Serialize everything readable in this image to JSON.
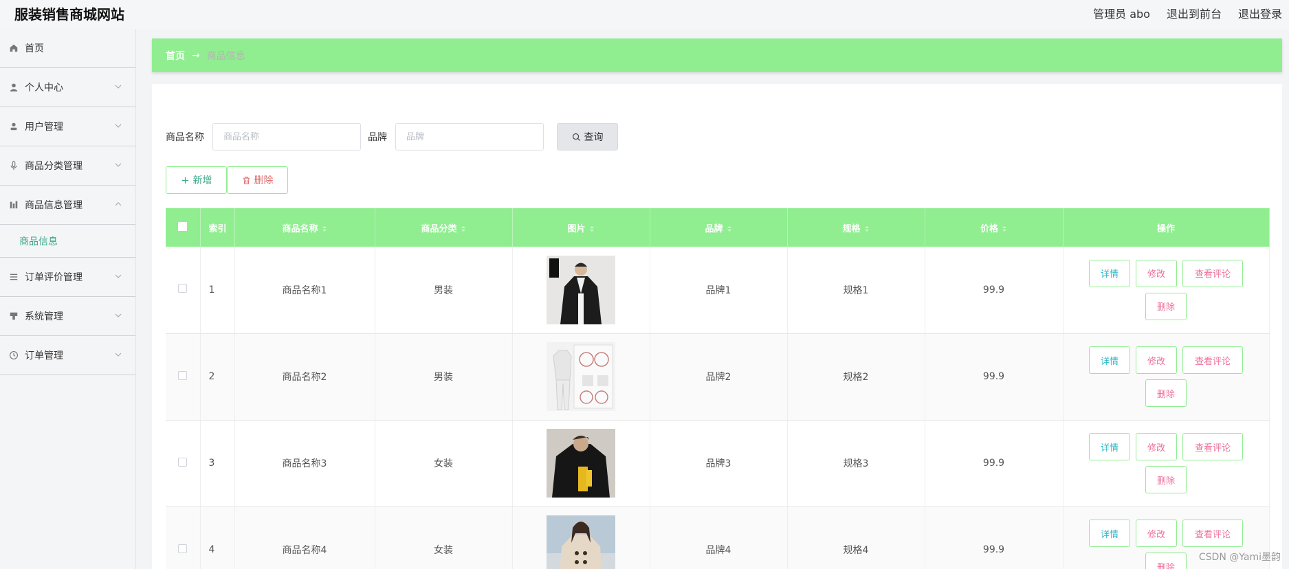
{
  "header": {
    "title": "服装销售商城网站",
    "user": "管理员 abo",
    "to_front": "退出到前台",
    "logout": "退出登录"
  },
  "sidebar": {
    "items": [
      {
        "label": "首页",
        "icon": "home-icon"
      },
      {
        "label": "个人中心",
        "icon": "user-icon"
      },
      {
        "label": "用户管理",
        "icon": "user-manage-icon"
      },
      {
        "label": "商品分类管理",
        "icon": "microphone-icon"
      },
      {
        "label": "商品信息管理",
        "icon": "chart-icon"
      },
      {
        "label": "订单评价管理",
        "icon": "list-icon"
      },
      {
        "label": "系统管理",
        "icon": "stamp-icon"
      },
      {
        "label": "订单管理",
        "icon": "clock-icon"
      }
    ],
    "sub_item": "商品信息"
  },
  "breadcrumb": {
    "home": "首页",
    "arrow": "→",
    "current": "商品信息"
  },
  "search": {
    "name_label": "商品名称",
    "name_placeholder": "商品名称",
    "brand_label": "品牌",
    "brand_placeholder": "品牌",
    "query_button": "查询"
  },
  "actions": {
    "add": "新增",
    "delete": "删除"
  },
  "table": {
    "headers": {
      "index": "索引",
      "name": "商品名称",
      "category": "商品分类",
      "image": "图片",
      "brand": "品牌",
      "spec": "规格",
      "price": "价格",
      "ops": "操作"
    },
    "rows": [
      {
        "index": "1",
        "name": "商品名称1",
        "category": "男装",
        "brand": "品牌1",
        "spec": "规格1",
        "price": "99.9"
      },
      {
        "index": "2",
        "name": "商品名称2",
        "category": "男装",
        "brand": "品牌2",
        "spec": "规格2",
        "price": "99.9"
      },
      {
        "index": "3",
        "name": "商品名称3",
        "category": "女装",
        "brand": "品牌3",
        "spec": "规格3",
        "price": "99.9"
      },
      {
        "index": "4",
        "name": "商品名称4",
        "category": "女装",
        "brand": "品牌4",
        "spec": "规格4",
        "price": "99.9"
      }
    ],
    "row_buttons": {
      "detail": "详情",
      "edit": "修改",
      "review": "查看评论",
      "delete": "删除"
    }
  },
  "watermark": "CSDN @Yami墨韵",
  "colors": {
    "accent": "#90ee90",
    "link_teal": "#3aa98a",
    "detail_text": "#2fb6c8",
    "danger_text": "#ef6f9b"
  }
}
